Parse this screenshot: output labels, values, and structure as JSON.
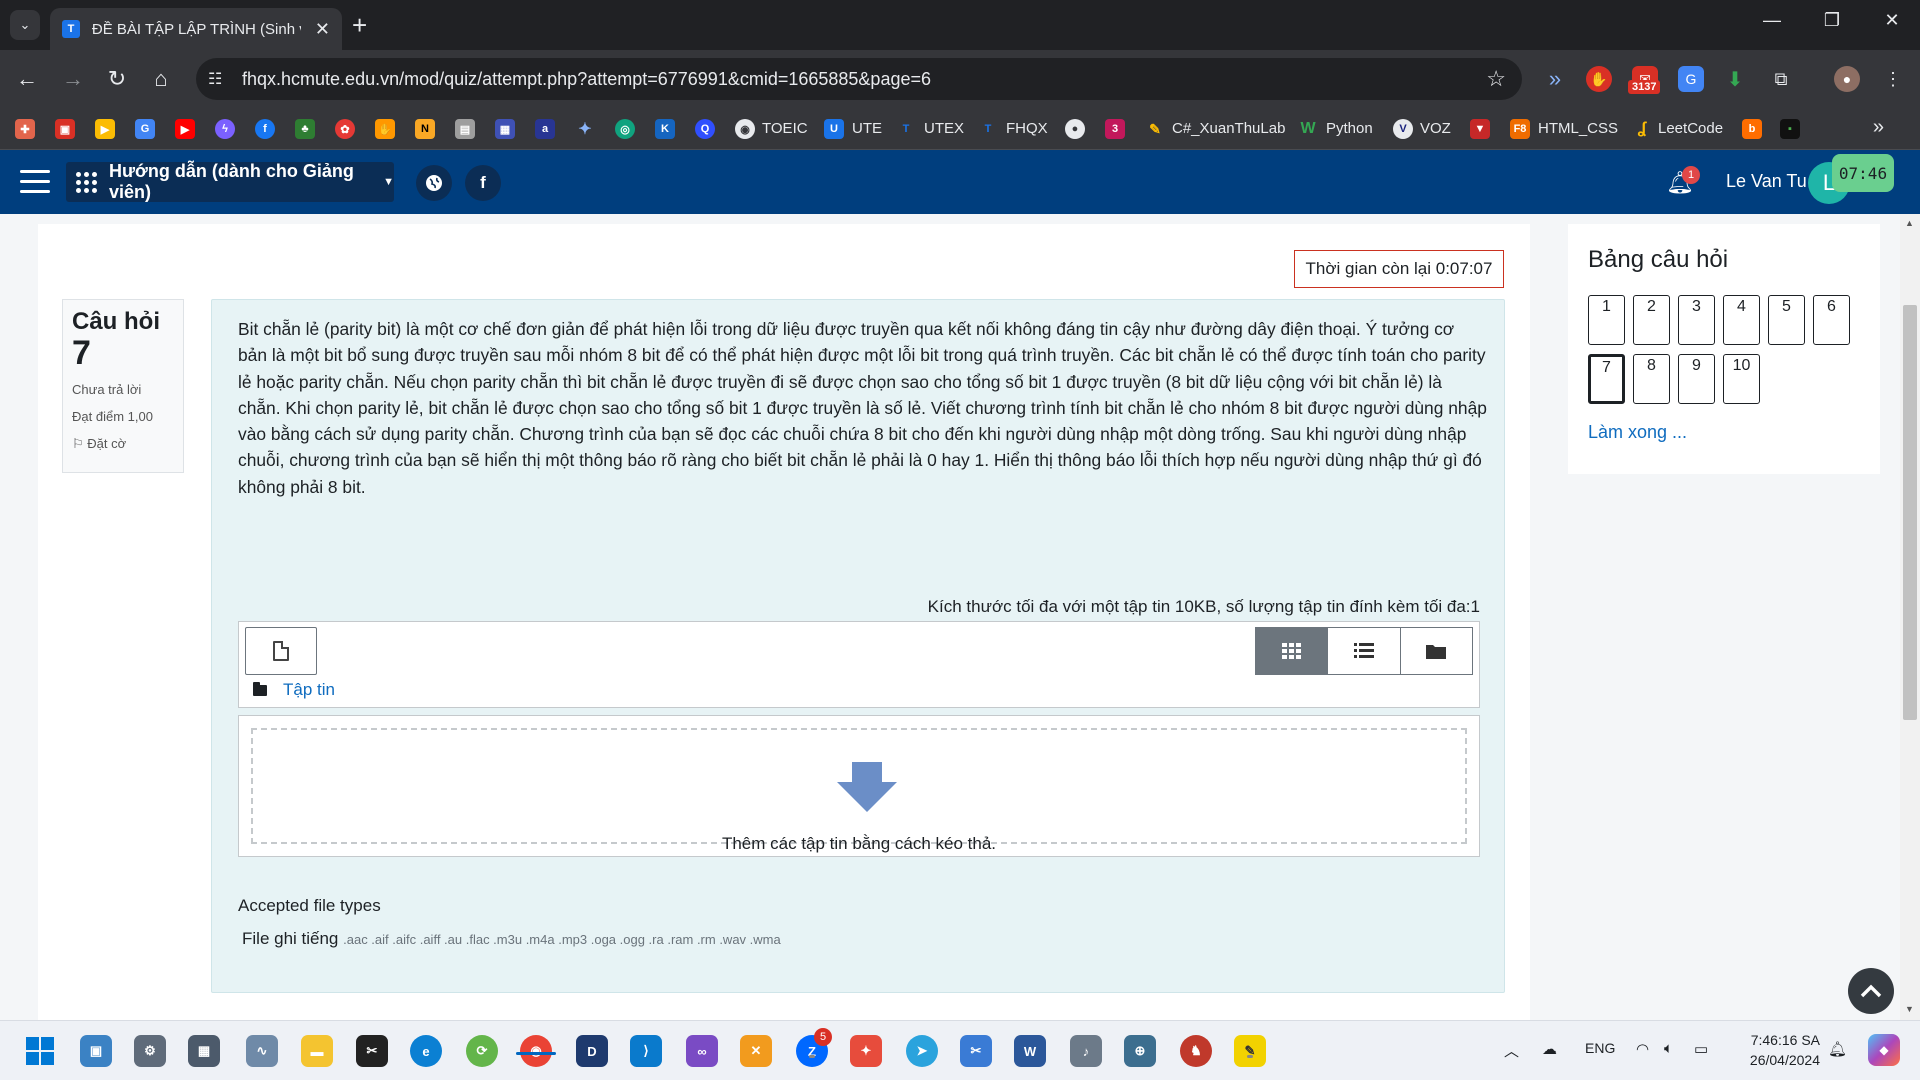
{
  "browser": {
    "tab_title": "ĐỀ BÀI TẬP LẬP TRÌNH (Sinh viê",
    "tab_favicon": "T",
    "url": "fhqx.hcmute.edu.vn/mod/quiz/attempt.php?attempt=6776991&cmid=1665885&page=6",
    "ext_badge": "3137",
    "bookmarks": {
      "toeic": "TOEIC",
      "ute": "UTE",
      "utex": "UTEX",
      "fhqx": "FHQX",
      "csharp": "C#_XuanThuLab",
      "python": "Python",
      "voz": "VOZ",
      "htmlcss": "HTML_CSS",
      "leetcode": "LeetCode"
    }
  },
  "navbar": {
    "guide_label": "Hướng dẫn (dành cho Giảng viên)",
    "notif_count": "1",
    "user_name": "Le Van Tu",
    "avatar_initial": "L",
    "clock": "07:46"
  },
  "timer": "Thời gian còn lại 0:07:07",
  "question": {
    "label": "Câu hỏi",
    "number": "7",
    "status": "Chưa trả lời",
    "mark": "Đạt điểm 1,00",
    "flag": "Đặt cờ",
    "text": "Bit chẵn lẻ (parity bit) là một cơ chế đơn giản để phát hiện lỗi trong dữ liệu được truyền qua kết nối không đáng tin cậy như đường dây điện thoại. Ý tưởng cơ bản là một bit bổ sung được truyền sau mỗi nhóm 8 bit để có thể phát hiện được một lỗi bit trong quá trình truyền. Các bit chẵn lẻ có thể được tính toán cho parity lẻ hoặc parity chẵn. Nếu chọn parity chẵn thì bit chẵn lẻ được truyền đi sẽ được chọn sao cho tổng số bit 1 được truyền (8 bit dữ liệu cộng với bit chẵn lẻ) là chẵn. Khi chọn parity lẻ, bit chẵn lẻ được chọn sao cho tổng số bit 1 được truyền là số lẻ.  Viết chương trình tính bit chẵn lẻ cho nhóm 8 bit được người dùng nhập vào bằng cách sử dụng  parity chẵn. Chương trình của bạn sẽ đọc các chuỗi chứa 8 bit cho đến khi người dùng nhập một dòng trống. Sau khi người dùng nhập chuỗi, chương trình của bạn sẽ hiển thị một thông báo rõ ràng cho biết bit chẵn lẻ phải là 0 hay 1. Hiển thị thông báo lỗi thích hợp nếu người dùng nhập thứ gì đó không phải 8 bit."
  },
  "filemanager": {
    "max_note": "Kích thước tối đa với một tập tin 10KB, số lượng tập tin đính kèm tối đa:1",
    "path_label": "Tập tin",
    "drop_text": "Thêm các tập tin bằng cách kéo thả.",
    "accepted_label": "Accepted file types",
    "type_name": "File ghi tiếng",
    "type_exts": ".aac .aif .aifc .aiff .au .flac .m3u .m4a .mp3 .oga .ogg .ra .ram .rm .wav .wma"
  },
  "nav_panel": {
    "title": "Bảng câu hỏi",
    "buttons": [
      "1",
      "2",
      "3",
      "4",
      "5",
      "6",
      "7",
      "8",
      "9",
      "10"
    ],
    "current": "7",
    "finish": "Làm xong ..."
  },
  "taskbar": {
    "zalo_badge": "5",
    "lang": "ENG",
    "time": "7:46:16 SA",
    "date": "26/04/2024"
  }
}
